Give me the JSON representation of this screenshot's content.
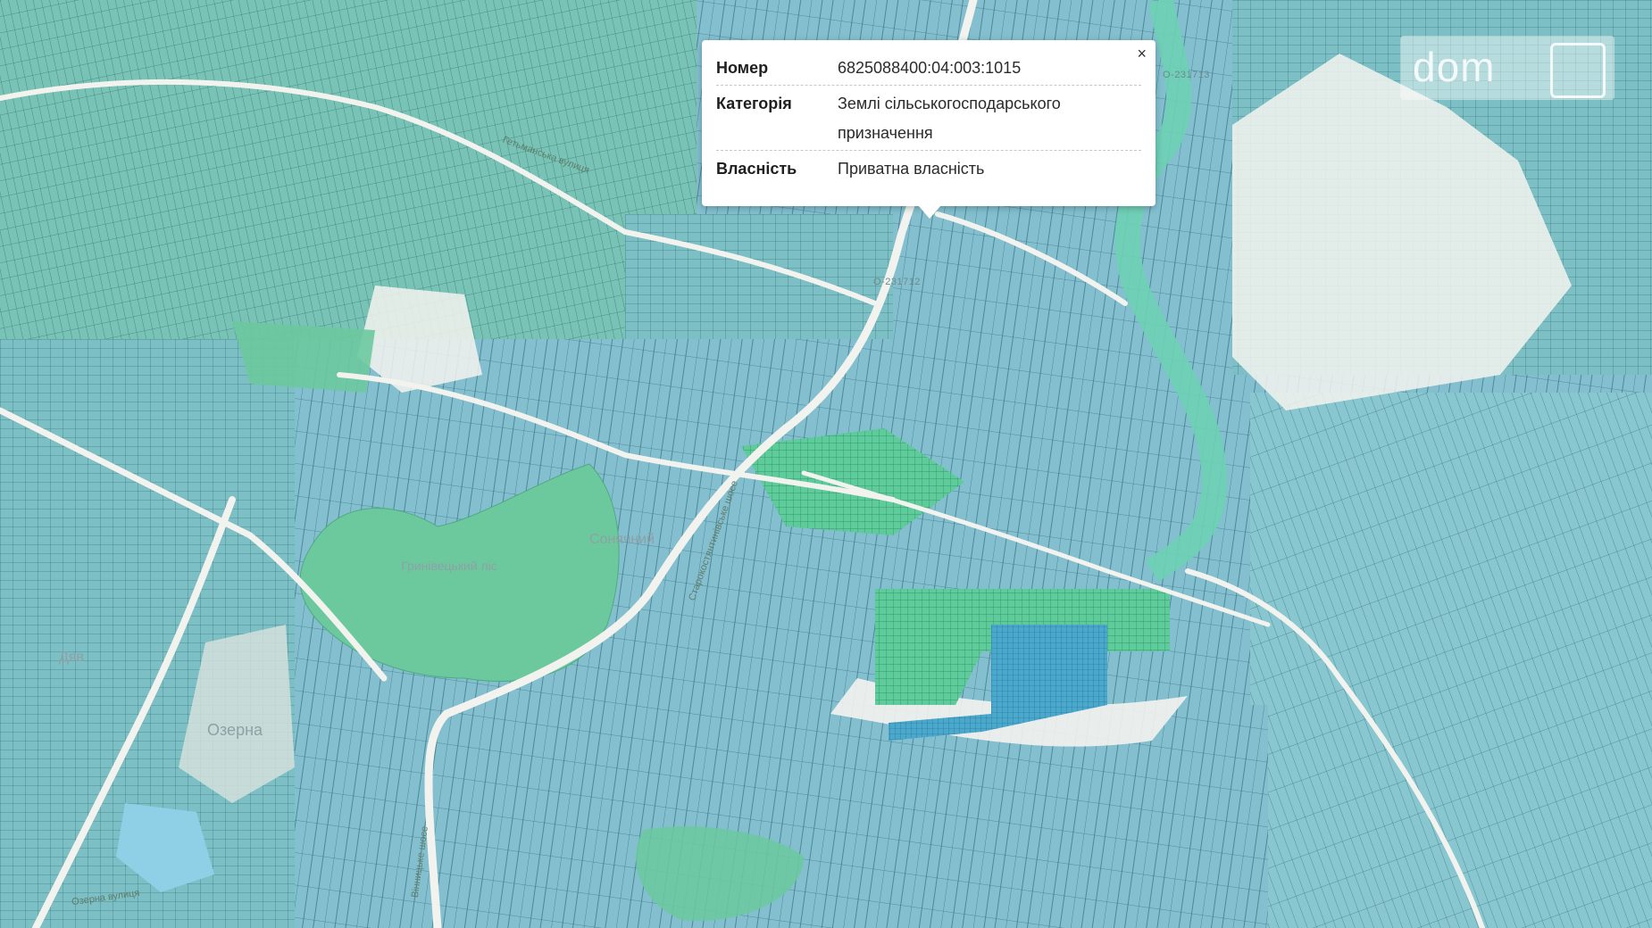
{
  "popup": {
    "close_symbol": "×",
    "rows": [
      {
        "key": "Номер",
        "value": "6825088400:04:003:1015"
      },
      {
        "key": "Категорія",
        "value": "Землі сільськогосподарського призначення"
      },
      {
        "key": "Власність",
        "value": "Приватна власність"
      }
    ]
  },
  "map_labels": {
    "forest": "Гринівецький ліс",
    "district": "Сонячний",
    "town_west": "Озерна",
    "town_west2": "Дяв",
    "street_1": "Гетьманська вулиця",
    "street_2": "Озерна вулиця",
    "highway": "Старокостянтинівське шосе",
    "highway_2": "Вінницьке шосе",
    "route_1": "О-231713",
    "route_2": "О-231712"
  },
  "watermark": {
    "text": "dom",
    "badge_icon": "ria-logo-icon"
  },
  "colors": {
    "parcel_teal": "#6fb7b8",
    "parcel_blue": "#5aa3c7",
    "parcel_green": "#5dc79a",
    "road_white": "#f2f2ee",
    "river": "#6ed0b4",
    "forest": "#6cc99e"
  }
}
